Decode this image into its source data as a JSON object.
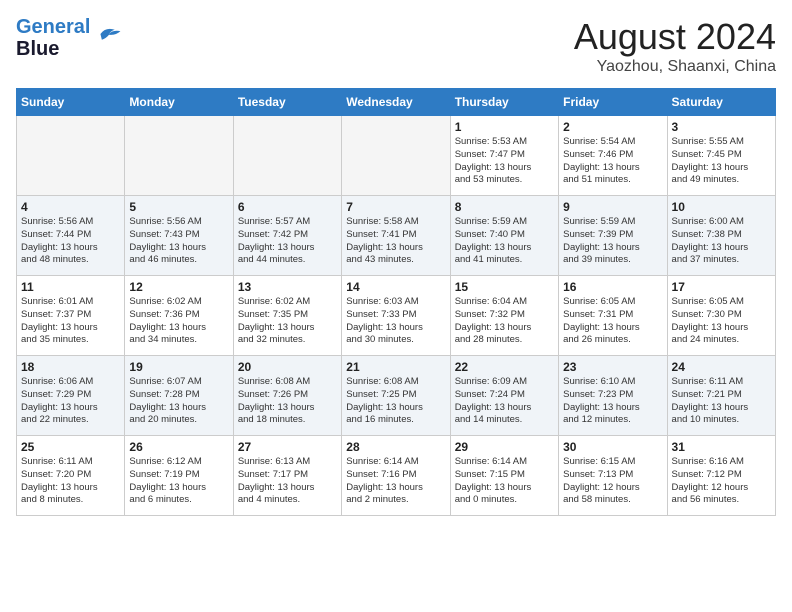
{
  "header": {
    "logo_line1": "General",
    "logo_line2": "Blue",
    "month_year": "August 2024",
    "location": "Yaozhou, Shaanxi, China"
  },
  "weekdays": [
    "Sunday",
    "Monday",
    "Tuesday",
    "Wednesday",
    "Thursday",
    "Friday",
    "Saturday"
  ],
  "weeks": [
    [
      {
        "day": "",
        "info": ""
      },
      {
        "day": "",
        "info": ""
      },
      {
        "day": "",
        "info": ""
      },
      {
        "day": "",
        "info": ""
      },
      {
        "day": "1",
        "info": "Sunrise: 5:53 AM\nSunset: 7:47 PM\nDaylight: 13 hours\nand 53 minutes."
      },
      {
        "day": "2",
        "info": "Sunrise: 5:54 AM\nSunset: 7:46 PM\nDaylight: 13 hours\nand 51 minutes."
      },
      {
        "day": "3",
        "info": "Sunrise: 5:55 AM\nSunset: 7:45 PM\nDaylight: 13 hours\nand 49 minutes."
      }
    ],
    [
      {
        "day": "4",
        "info": "Sunrise: 5:56 AM\nSunset: 7:44 PM\nDaylight: 13 hours\nand 48 minutes."
      },
      {
        "day": "5",
        "info": "Sunrise: 5:56 AM\nSunset: 7:43 PM\nDaylight: 13 hours\nand 46 minutes."
      },
      {
        "day": "6",
        "info": "Sunrise: 5:57 AM\nSunset: 7:42 PM\nDaylight: 13 hours\nand 44 minutes."
      },
      {
        "day": "7",
        "info": "Sunrise: 5:58 AM\nSunset: 7:41 PM\nDaylight: 13 hours\nand 43 minutes."
      },
      {
        "day": "8",
        "info": "Sunrise: 5:59 AM\nSunset: 7:40 PM\nDaylight: 13 hours\nand 41 minutes."
      },
      {
        "day": "9",
        "info": "Sunrise: 5:59 AM\nSunset: 7:39 PM\nDaylight: 13 hours\nand 39 minutes."
      },
      {
        "day": "10",
        "info": "Sunrise: 6:00 AM\nSunset: 7:38 PM\nDaylight: 13 hours\nand 37 minutes."
      }
    ],
    [
      {
        "day": "11",
        "info": "Sunrise: 6:01 AM\nSunset: 7:37 PM\nDaylight: 13 hours\nand 35 minutes."
      },
      {
        "day": "12",
        "info": "Sunrise: 6:02 AM\nSunset: 7:36 PM\nDaylight: 13 hours\nand 34 minutes."
      },
      {
        "day": "13",
        "info": "Sunrise: 6:02 AM\nSunset: 7:35 PM\nDaylight: 13 hours\nand 32 minutes."
      },
      {
        "day": "14",
        "info": "Sunrise: 6:03 AM\nSunset: 7:33 PM\nDaylight: 13 hours\nand 30 minutes."
      },
      {
        "day": "15",
        "info": "Sunrise: 6:04 AM\nSunset: 7:32 PM\nDaylight: 13 hours\nand 28 minutes."
      },
      {
        "day": "16",
        "info": "Sunrise: 6:05 AM\nSunset: 7:31 PM\nDaylight: 13 hours\nand 26 minutes."
      },
      {
        "day": "17",
        "info": "Sunrise: 6:05 AM\nSunset: 7:30 PM\nDaylight: 13 hours\nand 24 minutes."
      }
    ],
    [
      {
        "day": "18",
        "info": "Sunrise: 6:06 AM\nSunset: 7:29 PM\nDaylight: 13 hours\nand 22 minutes."
      },
      {
        "day": "19",
        "info": "Sunrise: 6:07 AM\nSunset: 7:28 PM\nDaylight: 13 hours\nand 20 minutes."
      },
      {
        "day": "20",
        "info": "Sunrise: 6:08 AM\nSunset: 7:26 PM\nDaylight: 13 hours\nand 18 minutes."
      },
      {
        "day": "21",
        "info": "Sunrise: 6:08 AM\nSunset: 7:25 PM\nDaylight: 13 hours\nand 16 minutes."
      },
      {
        "day": "22",
        "info": "Sunrise: 6:09 AM\nSunset: 7:24 PM\nDaylight: 13 hours\nand 14 minutes."
      },
      {
        "day": "23",
        "info": "Sunrise: 6:10 AM\nSunset: 7:23 PM\nDaylight: 13 hours\nand 12 minutes."
      },
      {
        "day": "24",
        "info": "Sunrise: 6:11 AM\nSunset: 7:21 PM\nDaylight: 13 hours\nand 10 minutes."
      }
    ],
    [
      {
        "day": "25",
        "info": "Sunrise: 6:11 AM\nSunset: 7:20 PM\nDaylight: 13 hours\nand 8 minutes."
      },
      {
        "day": "26",
        "info": "Sunrise: 6:12 AM\nSunset: 7:19 PM\nDaylight: 13 hours\nand 6 minutes."
      },
      {
        "day": "27",
        "info": "Sunrise: 6:13 AM\nSunset: 7:17 PM\nDaylight: 13 hours\nand 4 minutes."
      },
      {
        "day": "28",
        "info": "Sunrise: 6:14 AM\nSunset: 7:16 PM\nDaylight: 13 hours\nand 2 minutes."
      },
      {
        "day": "29",
        "info": "Sunrise: 6:14 AM\nSunset: 7:15 PM\nDaylight: 13 hours\nand 0 minutes."
      },
      {
        "day": "30",
        "info": "Sunrise: 6:15 AM\nSunset: 7:13 PM\nDaylight: 12 hours\nand 58 minutes."
      },
      {
        "day": "31",
        "info": "Sunrise: 6:16 AM\nSunset: 7:12 PM\nDaylight: 12 hours\nand 56 minutes."
      }
    ]
  ]
}
